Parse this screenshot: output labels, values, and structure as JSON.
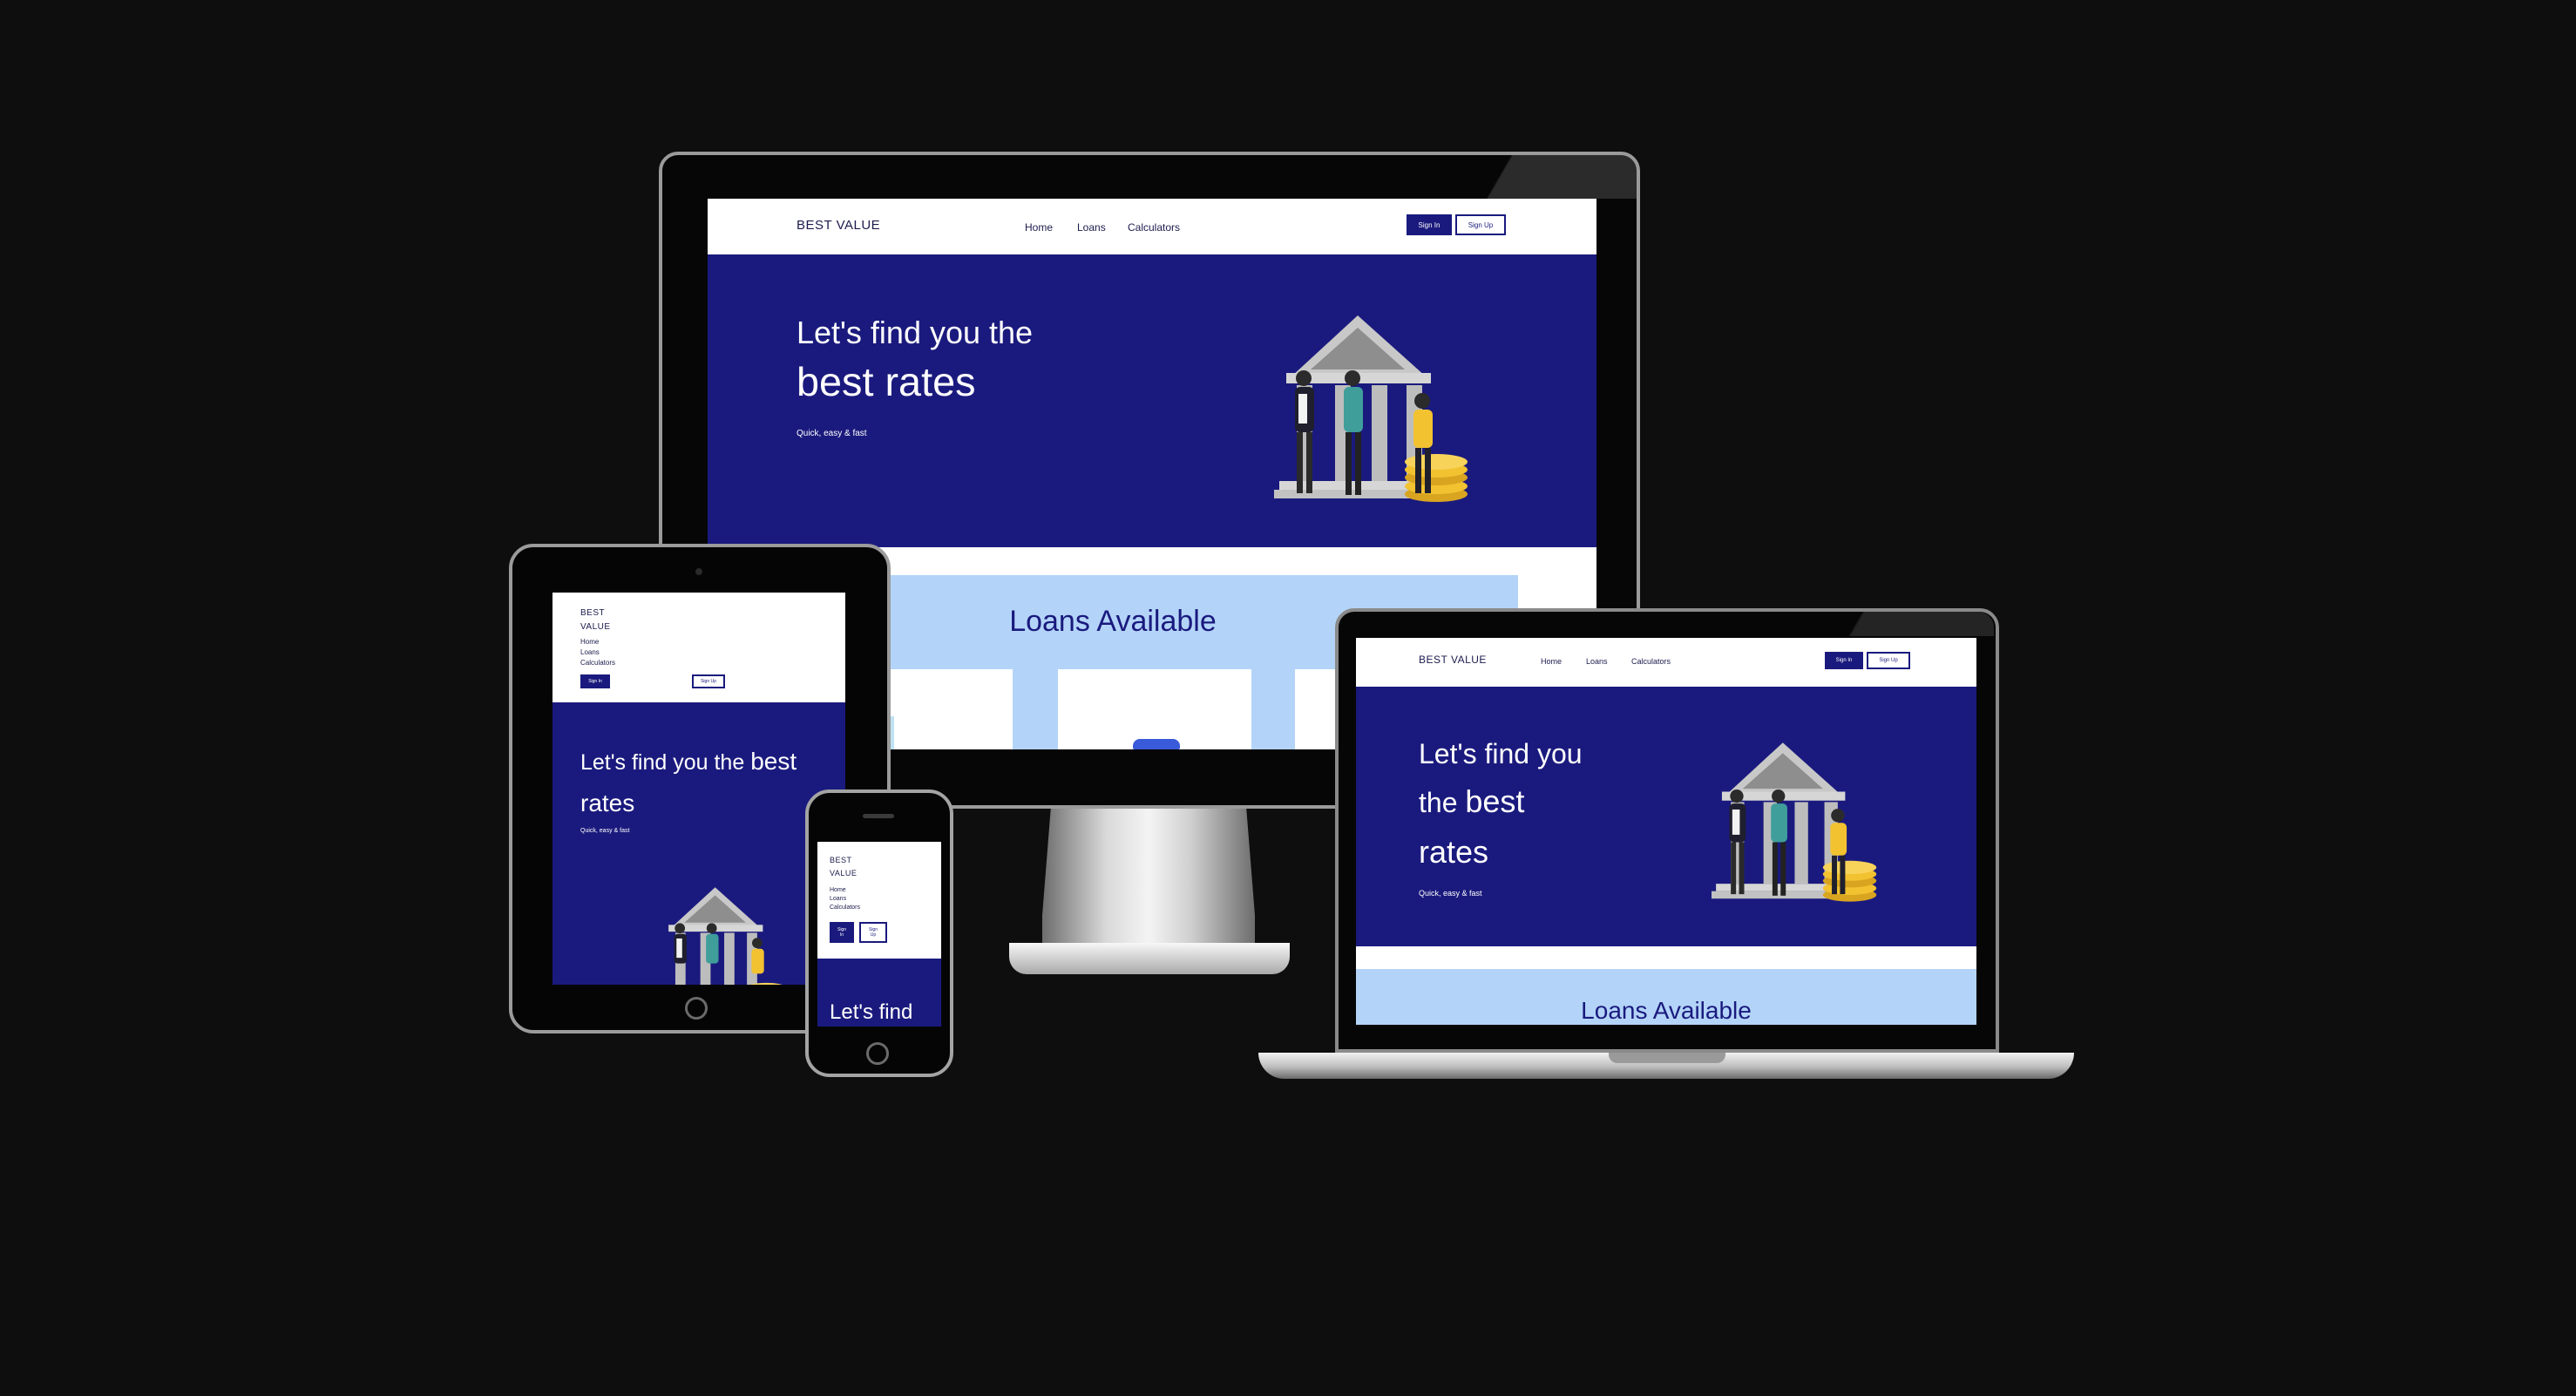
{
  "site": {
    "logo": "BEST VALUE",
    "logo_line1": "BEST",
    "logo_line2": "VALUE",
    "nav": [
      "Home",
      "Loans",
      "Calculators"
    ],
    "sign_in": "Sign In",
    "sign_up": "Sign Up",
    "hero_line1": "Let's find you the",
    "hero_line2": "best rates",
    "laptop_hero_1": "Let's find you",
    "laptop_hero_2a": "the ",
    "laptop_hero_2b": "best",
    "laptop_hero_3": "rates",
    "tablet_hero_1": "Let's find you the ",
    "tablet_hero_1b": "best",
    "tablet_hero_2": "rates",
    "phone_hero": "Let's find",
    "tagline": "Quick, easy & fast",
    "loans_title": "Loans Available",
    "phone_sign_in_1": "Sign",
    "phone_sign_in_2": "In",
    "phone_sign_up_1": "Sign",
    "phone_sign_up_2": "Up"
  },
  "colors": {
    "background": "#0e0e0e",
    "brand_navy": "#1a1a7e",
    "loans_band": "#b3d4f8",
    "coin_yellow": "#f2c230",
    "bank_grey": "#b5b5b5"
  },
  "illustration": "bank-building-with-people-and-coins"
}
